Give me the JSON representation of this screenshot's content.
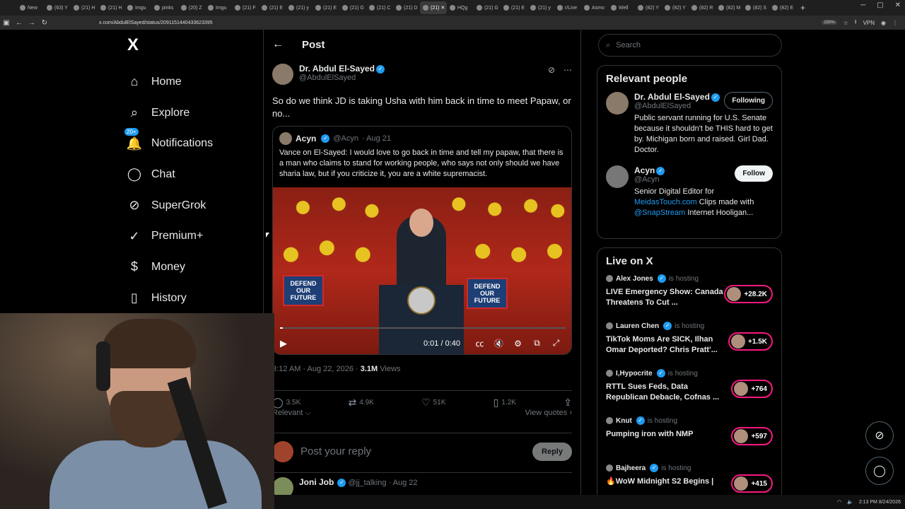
{
  "browser": {
    "tabs": [
      "New",
      "(63) Y",
      "(21) H",
      "(21) H",
      "Imgu",
      "pinks",
      "(20) Z",
      "Imgu",
      "(21) F",
      "(21) E",
      "(21) y",
      "(21) E",
      "(21) G",
      "(21) C",
      "(21) D",
      "(21) ✕",
      "HQg",
      "(21) G",
      "(21) E",
      "(21) y",
      "r/Live",
      "Asmo",
      "Well",
      "(82) Y",
      "(82) Y",
      "(82) R",
      "(82) M",
      "(82) S",
      "(82) E"
    ],
    "url": "x.com/AbdulElSayed/status/2091151440433623395",
    "zoom": "150%",
    "vpn": "VPN"
  },
  "nav": {
    "logo": "X",
    "items": [
      {
        "label": "Home",
        "icon": "home-icon",
        "glyph": "⌂"
      },
      {
        "label": "Explore",
        "icon": "search-icon",
        "glyph": "⌕"
      },
      {
        "label": "Notifications",
        "icon": "bell-icon",
        "glyph": "🔔"
      },
      {
        "label": "Chat",
        "icon": "chat-icon",
        "glyph": "◯"
      },
      {
        "label": "SuperGrok",
        "icon": "grok-icon",
        "glyph": "⊘"
      },
      {
        "label": "Premium+",
        "icon": "premium-icon",
        "glyph": "✓"
      },
      {
        "label": "Money",
        "icon": "money-icon",
        "glyph": "$"
      },
      {
        "label": "History",
        "icon": "bookmark-icon",
        "glyph": "▯"
      }
    ],
    "notif_badge": "20+"
  },
  "post": {
    "header_title": "Post",
    "author_name": "Dr. Abdul El-Sayed",
    "author_handle": "@AbdulElSayed",
    "text": "So do we think JD is taking Usha with him back in time to meet Papaw, or no...",
    "quote": {
      "name": "Acyn",
      "handle": "@Acyn",
      "date": "· Aug 21",
      "text": "Vance on El-Sayed: I would love to go back in time and tell my papaw, that there is a man who claims to stand for working people, who says not only should we have sharia law, but if you criticize it, you are a white supremacist.",
      "sign_left": "DEFEND OUR FUTURE",
      "sign_right": "DEFEND OUR FUTURE",
      "video_time": "0:01 / 0:40",
      "progress": 0.004
    },
    "timestamp": "3:12 AM · Aug 22, 2026 · ",
    "views_count": "3.1M",
    "views_label": " Views",
    "stats": {
      "replies": "3.5K",
      "reposts": "4.9K",
      "likes": "51K",
      "bookmarks": "1.2K"
    },
    "relevant_label": "Relevant ⌵",
    "view_quotes": "View quotes ›",
    "reply_placeholder": "Post your reply",
    "reply_button": "Reply",
    "next_name": "Joni Job",
    "next_handle": "@jj_talking",
    "next_date": "· Aug 22"
  },
  "right": {
    "search_placeholder": "Search",
    "relevant_title": "Relevant people",
    "people": [
      {
        "name": "Dr. Abdul El-Sayed",
        "handle": "@AbdulElSayed",
        "button": "Following",
        "bio": "Public servant running for U.S. Senate because it shouldn't be THIS hard to get by. Michigan born and raised. Girl Dad. Doctor."
      },
      {
        "name": "Acyn",
        "handle": "@Acyn",
        "button": "Follow",
        "bio_pre": "Senior Digital Editor for ",
        "bio_link1": "MeidasTouch.com",
        "bio_mid": " Clips made with ",
        "bio_link2": "@SnapStream",
        "bio_post": " Internet Hooligan..."
      }
    ],
    "live_title": "Live on X",
    "live": [
      {
        "host": "Alex Jones",
        "sub": "is hosting",
        "title": "LIVE Emergency Show: Canada Threatens To Cut ...",
        "count": "+28.2K"
      },
      {
        "host": "Lauren Chen",
        "sub": "is hosting",
        "title": "TikTok Moms Are SICK, Ilhan Omar Deported? Chris Pratt'...",
        "count": "+1.5K"
      },
      {
        "host": "I,Hypocrite",
        "sub": "is hosting",
        "title": "RTTL Sues Feds, Data Republican Debacle, Cofnas ...",
        "count": "+764"
      },
      {
        "host": "Knut",
        "sub": "is hosting",
        "title": "Pumping iron with NMP",
        "count": "+597"
      },
      {
        "host": "Bajheera",
        "sub": "is hosting",
        "title": "🔥WoW Midnight S2 Begins |",
        "count": "+415"
      }
    ]
  },
  "taskbar": {
    "time": "2:13 PM",
    "date": "8/24/2026"
  }
}
